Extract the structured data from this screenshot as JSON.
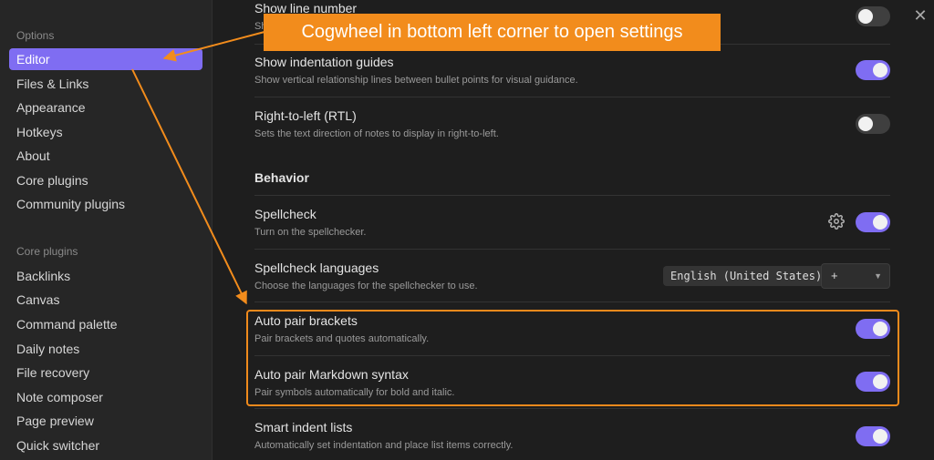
{
  "sidebar": {
    "options_heading": "Options",
    "options_items": [
      "Editor",
      "Files & Links",
      "Appearance",
      "Hotkeys",
      "About",
      "Core plugins",
      "Community plugins"
    ],
    "active_item": "Editor",
    "core_plugins_heading": "Core plugins",
    "core_plugin_items": [
      "Backlinks",
      "Canvas",
      "Command palette",
      "Daily notes",
      "File recovery",
      "Note composer",
      "Page preview",
      "Quick switcher"
    ]
  },
  "window": {
    "close_glyph": "✕"
  },
  "settings": {
    "show_line_number": {
      "name": "Show line number",
      "desc_fragment": "Sh",
      "enabled": false
    },
    "show_indentation_guides": {
      "name": "Show indentation guides",
      "desc": "Show vertical relationship lines between bullet points for visual guidance.",
      "enabled": true
    },
    "right_to_left": {
      "name": "Right-to-left (RTL)",
      "desc": "Sets the text direction of notes to display in right-to-left.",
      "enabled": false
    },
    "behavior_heading": "Behavior",
    "spellcheck": {
      "name": "Spellcheck",
      "desc": "Turn on the spellchecker.",
      "enabled": true
    },
    "spellcheck_languages": {
      "name": "Spellcheck languages",
      "desc": "Choose the languages for the spellchecker to use.",
      "selected_language": "English (United States)",
      "add_label": "+"
    },
    "auto_pair_brackets": {
      "name": "Auto pair brackets",
      "desc": "Pair brackets and quotes automatically.",
      "enabled": true
    },
    "auto_pair_markdown": {
      "name": "Auto pair Markdown syntax",
      "desc": "Pair symbols automatically for bold and italic.",
      "enabled": true
    },
    "smart_indent_lists": {
      "name": "Smart indent lists",
      "desc": "Automatically set indentation and place list items correctly.",
      "enabled": true
    }
  },
  "annotation": {
    "callout_text": "Cogwheel in bottom left corner to open settings",
    "color": "#f28c1c"
  },
  "colors": {
    "accent": "#7f6df2",
    "background": "#1e1e1e",
    "sidebar": "#262626"
  },
  "icons": {
    "gear": "gear-icon",
    "close": "close-icon",
    "dropdown": "chevron-down-icon"
  }
}
